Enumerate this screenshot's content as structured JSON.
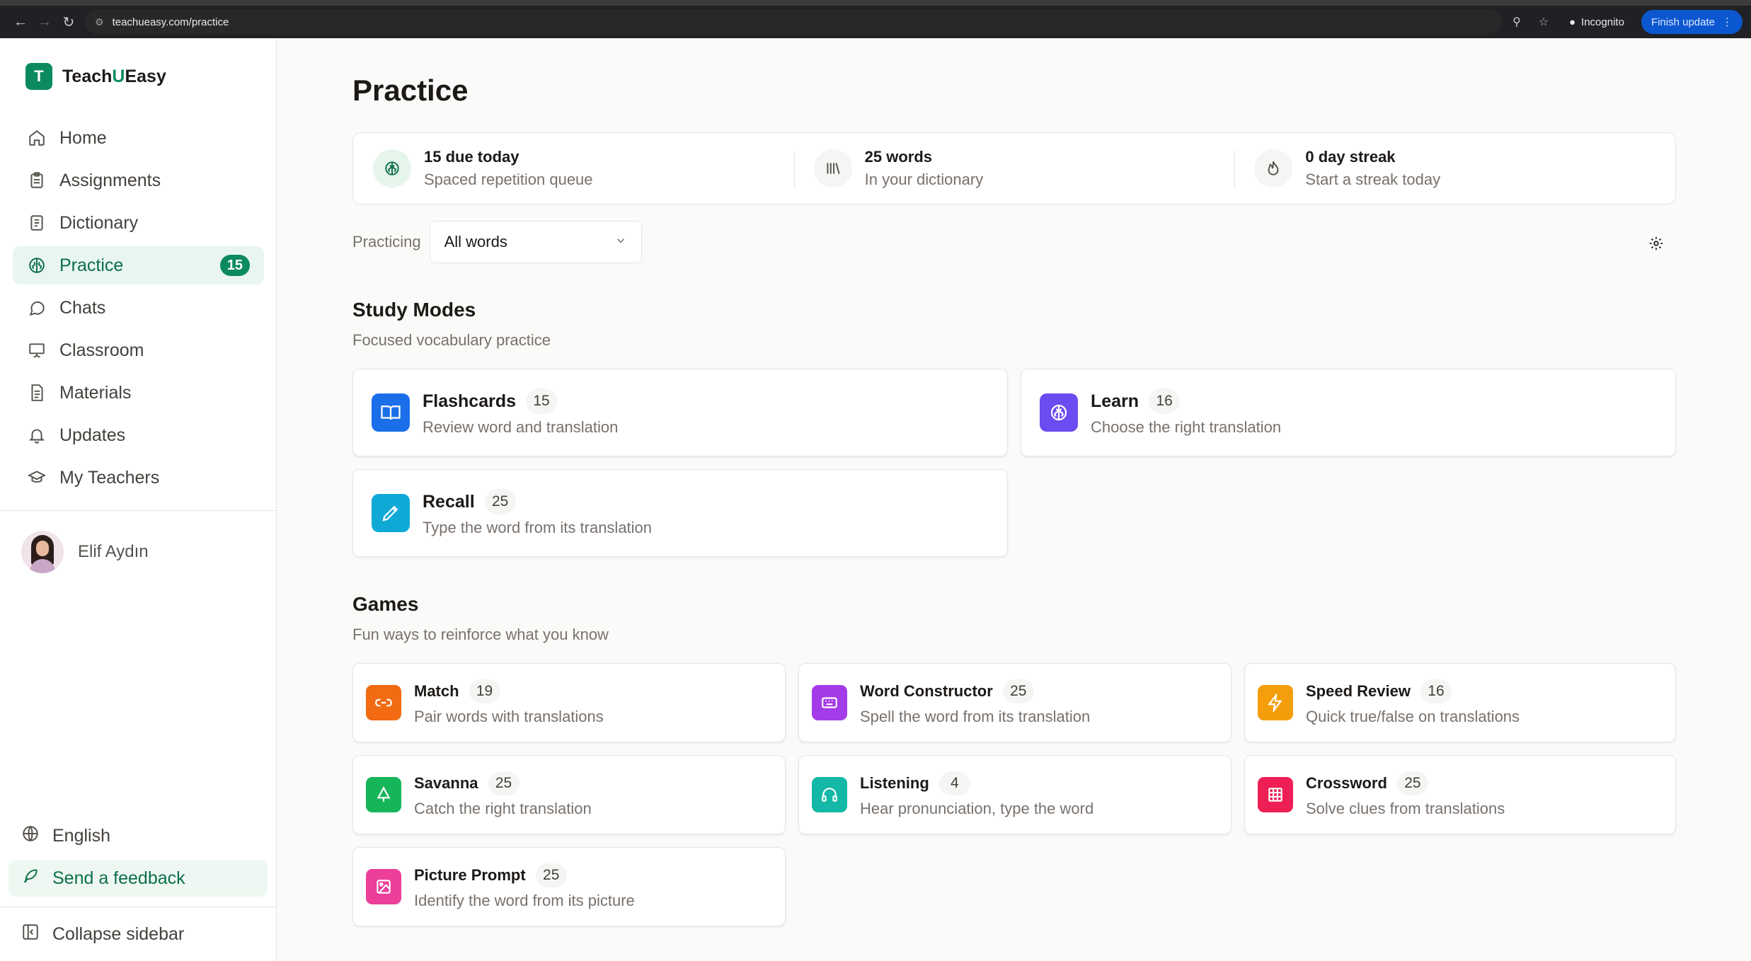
{
  "browser": {
    "url": "teachueasy.com/practice",
    "incognito_label": "Incognito",
    "finish_update_label": "Finish update"
  },
  "brand": {
    "logo_letter": "T",
    "name_part1": "Teach",
    "name_part2": "U",
    "name_part3": "Easy",
    "accent_color": "#0c8a5f"
  },
  "sidebar": {
    "items": [
      {
        "label": "Home",
        "icon": "home-icon"
      },
      {
        "label": "Assignments",
        "icon": "clipboard-icon"
      },
      {
        "label": "Dictionary",
        "icon": "book-icon"
      },
      {
        "label": "Practice",
        "icon": "brain-icon",
        "badge": "15",
        "active": true
      },
      {
        "label": "Chats",
        "icon": "chat-icon"
      },
      {
        "label": "Classroom",
        "icon": "presentation-icon"
      },
      {
        "label": "Materials",
        "icon": "document-icon"
      },
      {
        "label": "Updates",
        "icon": "bell-icon"
      },
      {
        "label": "My Teachers",
        "icon": "graduation-cap-icon"
      }
    ],
    "user_name": "Elif Aydın",
    "language": "English",
    "feedback": "Send a feedback",
    "collapse": "Collapse sidebar"
  },
  "main": {
    "title": "Practice",
    "stats": [
      {
        "title": "15 due today",
        "sub": "Spaced repetition queue"
      },
      {
        "title": "25 words",
        "sub": "In your dictionary"
      },
      {
        "title": "0 day streak",
        "sub": "Start a streak today"
      }
    ],
    "practicing_label": "Practicing",
    "practicing_value": "All words",
    "study_modes": {
      "title": "Study Modes",
      "subtitle": "Focused vocabulary practice",
      "cards": [
        {
          "name": "Flashcards",
          "count": "15",
          "desc": "Review word and translation",
          "color": "#1a6fe8"
        },
        {
          "name": "Learn",
          "count": "16",
          "desc": "Choose the right translation",
          "color": "#6c4cf0"
        },
        {
          "name": "Recall",
          "count": "25",
          "desc": "Type the word from its translation",
          "color": "#0fa9d6"
        }
      ]
    },
    "games": {
      "title": "Games",
      "subtitle": "Fun ways to reinforce what you know",
      "cards": [
        {
          "name": "Match",
          "count": "19",
          "desc": "Pair words with translations",
          "color": "#f26a12"
        },
        {
          "name": "Word Constructor",
          "count": "25",
          "desc": "Spell the word from its translation",
          "color": "#a43be8"
        },
        {
          "name": "Speed Review",
          "count": "16",
          "desc": "Quick true/false on translations",
          "color": "#f59e0b"
        },
        {
          "name": "Savanna",
          "count": "25",
          "desc": "Catch the right translation",
          "color": "#17b55a"
        },
        {
          "name": "Listening",
          "count": "4",
          "desc": "Hear pronunciation, type the word",
          "color": "#14b8a6"
        },
        {
          "name": "Crossword",
          "count": "25",
          "desc": "Solve clues from translations",
          "color": "#ee1f55"
        },
        {
          "name": "Picture Prompt",
          "count": "25",
          "desc": "Identify the word from its picture",
          "color": "#ec3f9a"
        }
      ]
    }
  }
}
